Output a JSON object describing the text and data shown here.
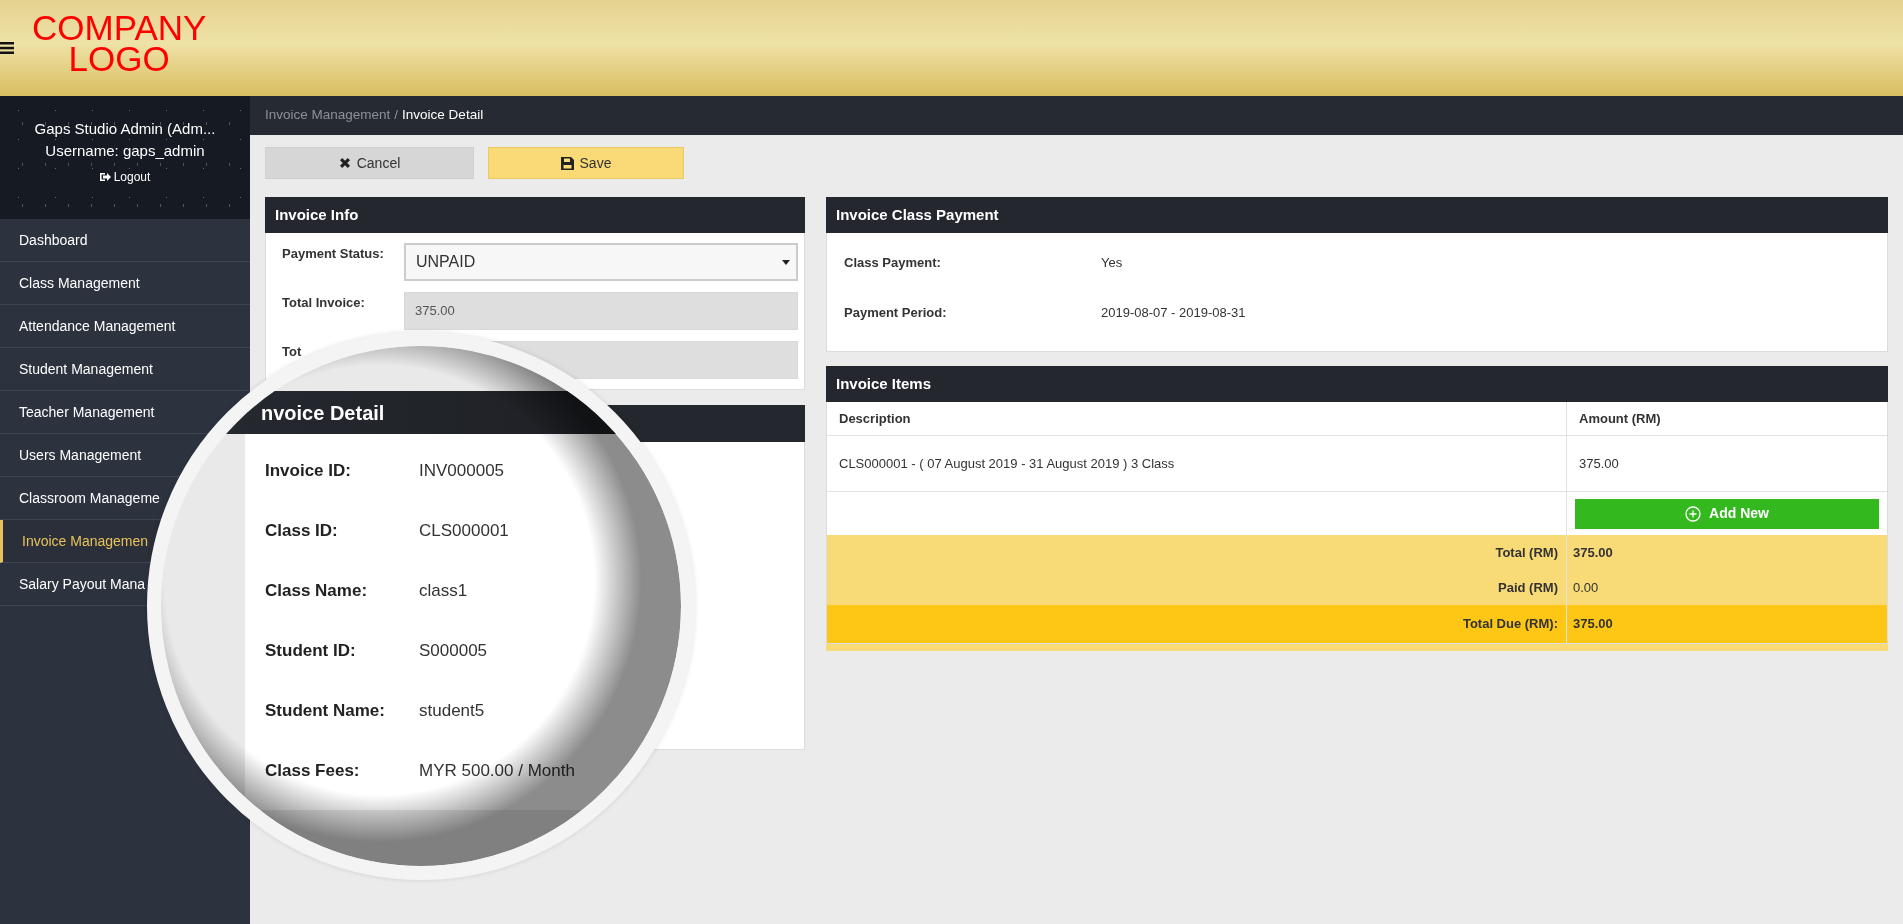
{
  "header": {
    "logo_lines": [
      "COMPANY",
      "LOGO"
    ]
  },
  "user": {
    "display_name": "Gaps Studio Admin (Adm...",
    "username": "Username: gaps_admin",
    "logout": "Logout"
  },
  "sidebar": {
    "items": [
      {
        "label": "Dashboard",
        "selected": false
      },
      {
        "label": "Class Management",
        "selected": false
      },
      {
        "label": "Attendance Management",
        "selected": false
      },
      {
        "label": "Student Management",
        "selected": false
      },
      {
        "label": "Teacher Management",
        "selected": false
      },
      {
        "label": "Users Management",
        "selected": false
      },
      {
        "label": "Classroom Manageme",
        "selected": false
      },
      {
        "label": "Invoice Managemen",
        "selected": true
      },
      {
        "label": "Salary Payout Mana",
        "selected": false
      }
    ]
  },
  "breadcrumb": {
    "separator": "/",
    "items": [
      {
        "label": "Invoice Management",
        "current": false
      },
      {
        "label": "Invoice Detail",
        "current": true
      }
    ]
  },
  "actions": [
    {
      "kind": "cancel",
      "label": "Cancel"
    },
    {
      "kind": "save",
      "label": "Save"
    }
  ],
  "invoice_info": {
    "title": "Invoice Info",
    "fields": [
      {
        "kind": "select",
        "label": "Payment Status:",
        "value": "UNPAID"
      },
      {
        "kind": "readonly",
        "label": "Total Invoice:",
        "value": "375.00"
      },
      {
        "kind": "readonly",
        "label": "Tot"
      }
    ]
  },
  "class_payment": {
    "title": "Invoice Class Payment",
    "fields": [
      {
        "label": "Class Payment:",
        "value": "Yes"
      },
      {
        "label": "Payment Period:",
        "value": "2019-08-07 - 2019-08-31"
      }
    ]
  },
  "invoice_items": {
    "title": "Invoice Items",
    "columns": [
      "Description",
      "Amount (RM)"
    ],
    "rows": [
      {
        "description": "CLS000001 - ( 07 August 2019 - 31 August 2019 ) 3 Class",
        "amount": "375.00"
      }
    ],
    "add_button": "Add New",
    "summary": [
      {
        "kind": "subtotal",
        "label": "Total (RM)",
        "value": "375.00",
        "bold": true
      },
      {
        "kind": "subtotal",
        "label": "Paid (RM)",
        "value": "0.00",
        "bold": false
      },
      {
        "kind": "due",
        "label": "Total Due (RM):",
        "value": "375.00",
        "bold": true
      }
    ]
  },
  "magnifier": {
    "title": "nvoice Detail",
    "fields": [
      {
        "label": "Invoice ID:",
        "value": "INV000005"
      },
      {
        "label": "Class ID:",
        "value": "CLS000001"
      },
      {
        "label": "Class Name:",
        "value": "class1"
      },
      {
        "label": "Student ID:",
        "value": "S000005"
      },
      {
        "label": "Student Name:",
        "value": "student5"
      },
      {
        "label": "Class Fees:",
        "value": "MYR 500.00 / Month"
      }
    ]
  }
}
